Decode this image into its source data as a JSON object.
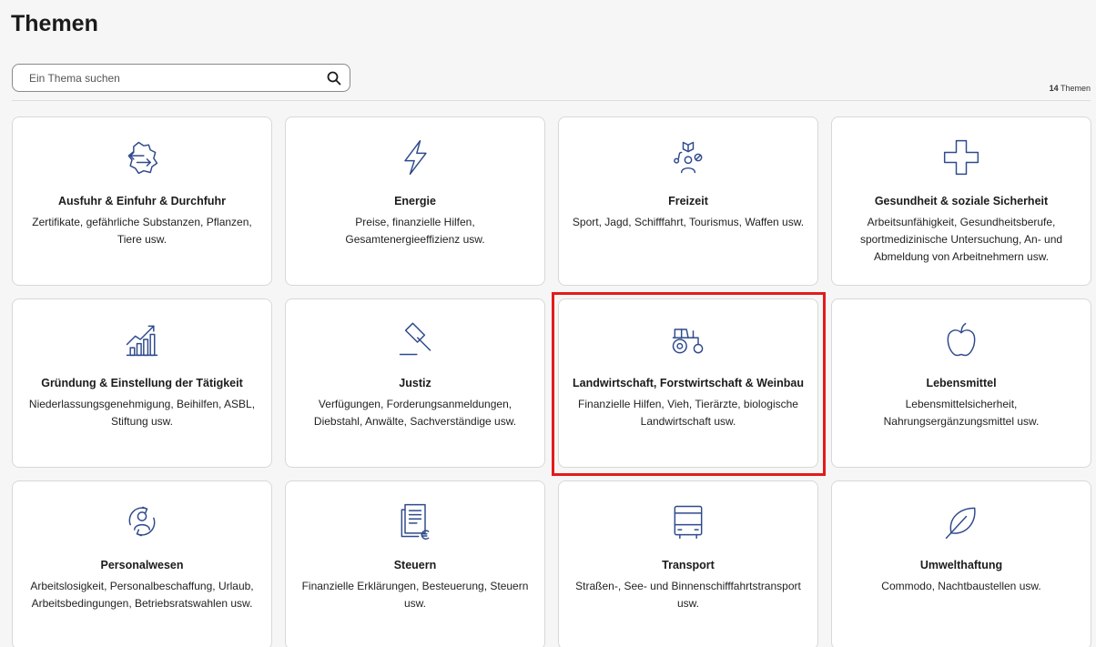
{
  "page": {
    "title": "Themen"
  },
  "search": {
    "placeholder": "Ein Thema suchen"
  },
  "count": {
    "number": "14",
    "label": "Themen"
  },
  "colors": {
    "icon_stroke": "#2f4a8c",
    "highlight": "#e31b1b"
  },
  "cards": [
    {
      "icon": "map-arrows-icon",
      "title": "Ausfuhr & Einfuhr & Durchfuhr",
      "desc": "Zertifikate, gefährliche Substanzen, Pflanzen, Tiere usw."
    },
    {
      "icon": "lightning-icon",
      "title": "Energie",
      "desc": "Preise, finanzielle Hilfen, Gesamtenergieeffizienz usw."
    },
    {
      "icon": "leisure-icon",
      "title": "Freizeit",
      "desc": "Sport, Jagd, Schifffahrt, Tourismus, Waffen usw."
    },
    {
      "icon": "medical-cross-icon",
      "title": "Gesundheit & soziale Sicherheit",
      "desc": "Arbeitsunfähigkeit, Gesundheitsberufe, sportmedizinische Untersuchung, An- und Abmeldung von Arbeitnehmern usw."
    },
    {
      "icon": "growth-chart-icon",
      "title": "Gründung & Einstellung der Tätigkeit",
      "desc": "Niederlassungsgenehmigung, Beihilfen, ASBL, Stiftung usw."
    },
    {
      "icon": "gavel-icon",
      "title": "Justiz",
      "desc": "Verfügungen, Forderungsanmeldungen, Diebstahl, Anwälte, Sachverständige usw."
    },
    {
      "icon": "tractor-icon",
      "title": "Landwirtschaft, Forstwirtschaft & Weinbau",
      "desc": "Finanzielle Hilfen, Vieh, Tierärzte, biologische Landwirtschaft usw."
    },
    {
      "icon": "apple-icon",
      "title": "Lebensmittel",
      "desc": "Lebensmittelsicherheit, Nahrungsergänzungsmittel usw."
    },
    {
      "icon": "person-cycle-icon",
      "title": "Personalwesen",
      "desc": "Arbeitslosigkeit, Personalbeschaffung, Urlaub, Arbeitsbedingungen, Betriebsratswahlen usw."
    },
    {
      "icon": "tax-document-icon",
      "title": "Steuern",
      "desc": "Finanzielle Erklärungen, Besteuerung, Steuern usw."
    },
    {
      "icon": "bus-icon",
      "title": "Transport",
      "desc": "Straßen-, See- und Binnenschifffahrtstransport usw."
    },
    {
      "icon": "leaf-icon",
      "title": "Umwelthaftung",
      "desc": "Commodo, Nachtbaustellen usw."
    }
  ]
}
